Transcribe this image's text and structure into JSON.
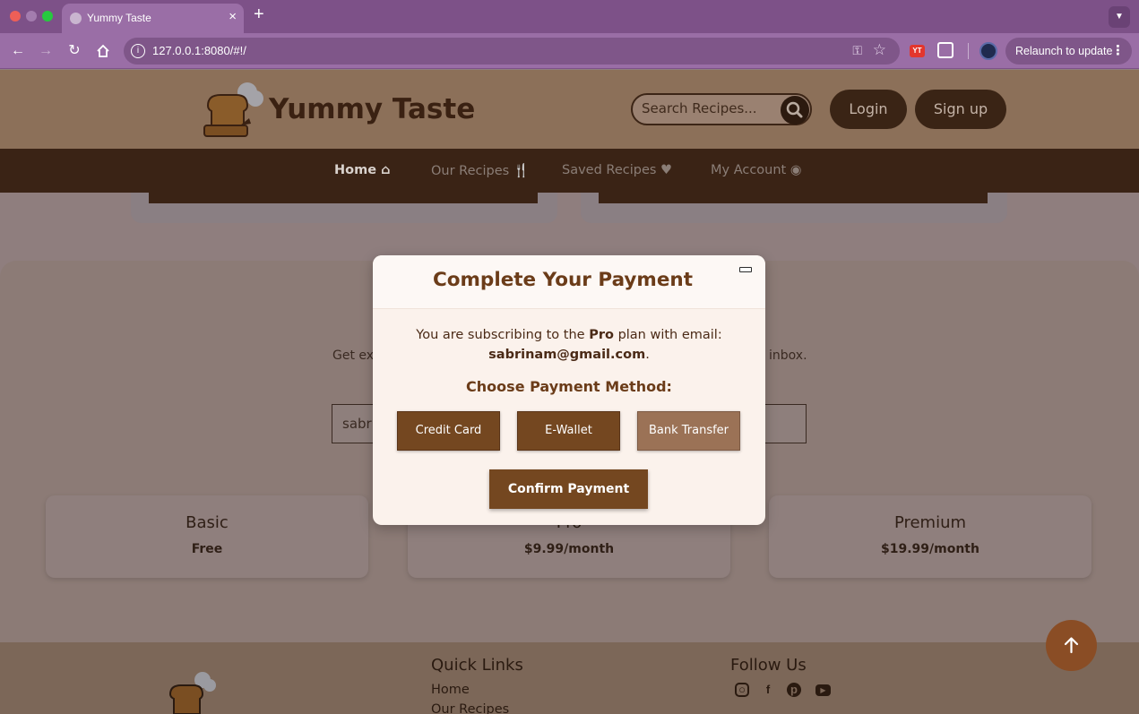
{
  "browser": {
    "tab_title": "Yummy Taste",
    "url": "127.0.0.1:8080/#!/",
    "relaunch_label": "Relaunch to update",
    "icons": [
      "back-icon",
      "forward-icon",
      "reload-icon",
      "home-icon",
      "site-info-icon",
      "key-icon",
      "star-icon",
      "extension-icon",
      "profile-avatar",
      "more-icon"
    ]
  },
  "header": {
    "brand": "Yummy Taste",
    "search_placeholder": "Search Recipes...",
    "login_label": "Login",
    "signup_label": "Sign up"
  },
  "nav": {
    "items": [
      {
        "label": "Home",
        "icon": "home-icon",
        "active": true
      },
      {
        "label": "Our Recipes",
        "icon": "utensils-icon",
        "active": false
      },
      {
        "label": "Saved Recipes",
        "icon": "heart-icon",
        "active": false
      },
      {
        "label": "My Account",
        "icon": "user-circle-icon",
        "active": false
      }
    ]
  },
  "subscribe": {
    "text_left": "Get ex",
    "text_right": "inbox.",
    "email_value_fragment": "sabri"
  },
  "plans": [
    {
      "name": "Basic",
      "price": "Free"
    },
    {
      "name": "Pro",
      "price": "$9.99/month"
    },
    {
      "name": "Premium",
      "price": "$19.99/month"
    }
  ],
  "footer": {
    "quick_links_heading": "Quick Links",
    "follow_heading": "Follow Us",
    "links": [
      "Home",
      "Our Recipes"
    ],
    "social": [
      "instagram-icon",
      "facebook-icon",
      "pinterest-icon",
      "youtube-icon"
    ]
  },
  "modal": {
    "title": "Complete Your Payment",
    "msg_prefix": "You are subscribing to the",
    "plan": "Pro",
    "msg_mid": "plan with email:",
    "email": "sabrinam@gmail.com",
    "msg_suffix": ".",
    "choose_label": "Choose Payment Method:",
    "methods": [
      "Credit Card",
      "E-Wallet",
      "Bank Transfer"
    ],
    "selected_method": "Bank Transfer",
    "confirm_label": "Confirm Payment"
  },
  "colors": {
    "brand_brown": "#744720",
    "nav_dark": "#3a2315",
    "chrome_purple": "#7d5188"
  }
}
